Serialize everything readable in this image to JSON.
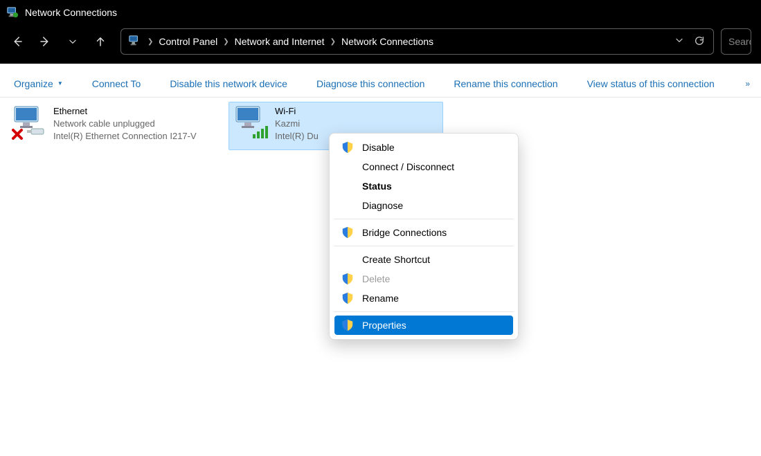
{
  "title": "Network Connections",
  "breadcrumb": {
    "items": [
      "Control Panel",
      "Network and Internet",
      "Network Connections"
    ]
  },
  "search": {
    "placeholder": "Search"
  },
  "commands": {
    "organize": "Organize",
    "connect_to": "Connect To",
    "disable": "Disable this network device",
    "diagnose": "Diagnose this connection",
    "rename": "Rename this connection",
    "view_status": "View status of this connection"
  },
  "connections": {
    "ethernet": {
      "name": "Ethernet",
      "status": "Network cable unplugged",
      "device": "Intel(R) Ethernet Connection I217-V"
    },
    "wifi": {
      "name": "Wi-Fi",
      "status": "Kazmi",
      "device": "Intel(R) Du"
    }
  },
  "context_menu": {
    "disable": "Disable",
    "connect": "Connect / Disconnect",
    "status": "Status",
    "diagnose": "Diagnose",
    "bridge": "Bridge Connections",
    "shortcut": "Create Shortcut",
    "delete": "Delete",
    "rename": "Rename",
    "properties": "Properties"
  }
}
